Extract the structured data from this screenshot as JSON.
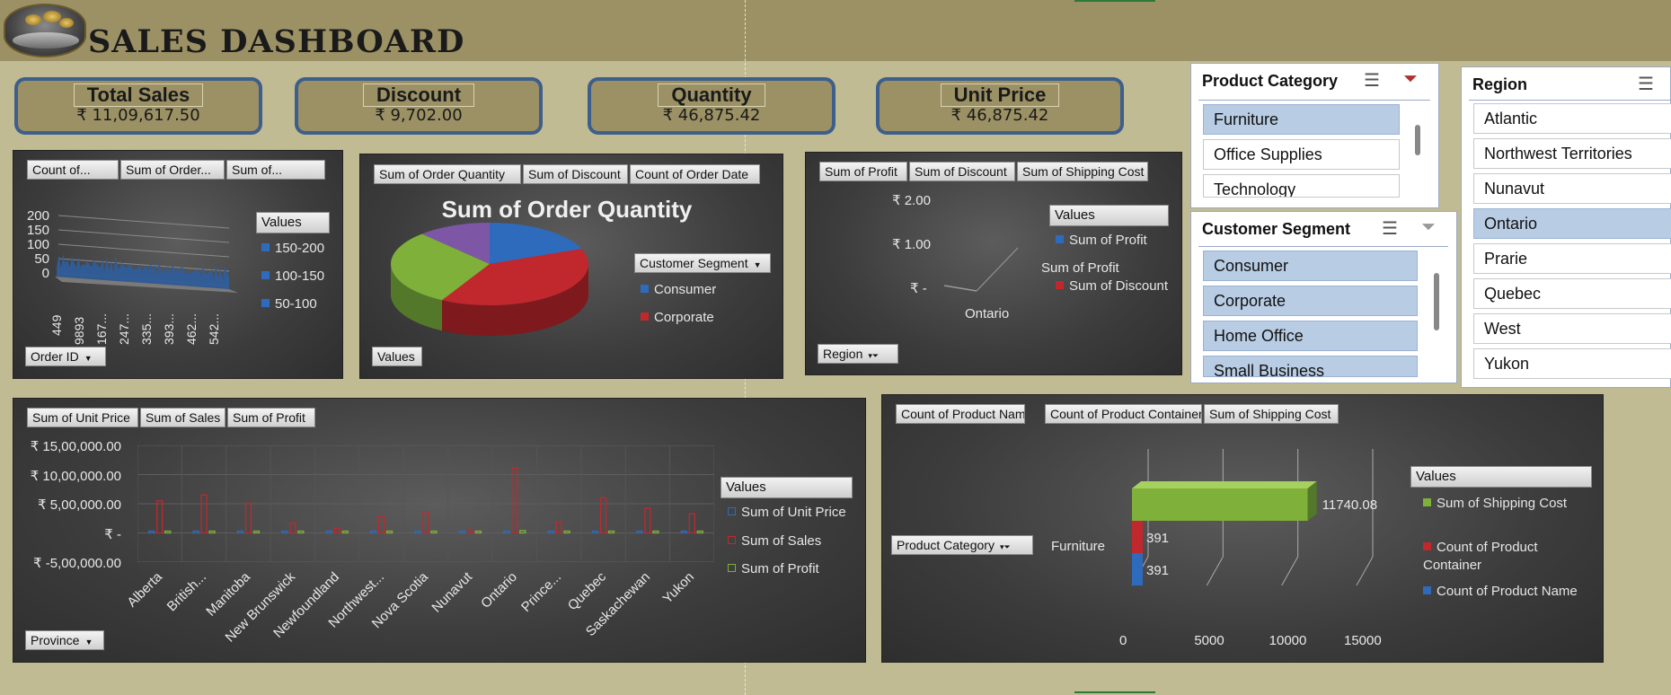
{
  "title": "SALES DASHBOARD",
  "kpis": [
    {
      "label": "Total Sales",
      "value": "₹ 11,09,617.50"
    },
    {
      "label": "Discount",
      "value": "₹ 9,702.00"
    },
    {
      "label": "Quantity",
      "value": "₹ 46,875.42"
    },
    {
      "label": "Unit Price",
      "value": "₹ 46,875.42"
    }
  ],
  "chart1": {
    "fields": [
      "Count of...",
      "Sum of Order...",
      "Sum of..."
    ],
    "axis_field": "Order ID",
    "legend_title": "Values",
    "legend": [
      "150-200",
      "100-150",
      "50-100"
    ],
    "y_ticks": [
      "200",
      "150",
      "100",
      "50",
      "0"
    ],
    "x_ticks": [
      "449",
      "9893",
      "167...",
      "247...",
      "335...",
      "393...",
      "462...",
      "542..."
    ]
  },
  "chart2": {
    "fields": [
      "Sum of Order Quantity",
      "Sum of Discount",
      "Count of Order Date"
    ],
    "title": "Sum of Order Quantity",
    "legend_field": "Customer Segment",
    "legend": [
      "Consumer",
      "Corporate"
    ],
    "values_button": "Values"
  },
  "chart3": {
    "fields": [
      "Sum of Profit",
      "Sum of Discount",
      "Sum of Shipping  Cost"
    ],
    "y_ticks": [
      "₹ 2.00",
      "₹ 1.00",
      "₹ -"
    ],
    "x_label": "Ontario",
    "legend_title": "Values",
    "legend": [
      "Sum of Profit",
      "Sum of Discount"
    ],
    "annotation": "Sum of Profit",
    "axis_field": "Region"
  },
  "chart4": {
    "fields": [
      "Sum of Unit Price",
      "Sum of Sales",
      "Sum of Profit"
    ],
    "y_ticks": [
      "₹ 15,00,000.00",
      "₹ 10,00,000.00",
      "₹ 5,00,000.00",
      "₹ -",
      "₹ -5,00,000.00"
    ],
    "legend_title": "Values",
    "legend": [
      "Sum of Unit Price",
      "Sum of Sales",
      "Sum of Profit"
    ],
    "axis_field": "Province"
  },
  "chart5": {
    "fields": [
      "Count of Product Name",
      "Count of Product Container",
      "Sum of Shipping  Cost"
    ],
    "filter_field": "Product Category",
    "category": "Furniture",
    "data_labels": [
      "11740.08",
      "391",
      "391"
    ],
    "x_ticks": [
      "0",
      "5000",
      "10000",
      "15000"
    ],
    "legend_title": "Values",
    "legend": [
      "Sum of Shipping Cost",
      "Count of Product Container",
      "Count of Product Name"
    ]
  },
  "slicers": {
    "product_category": {
      "title": "Product Category",
      "items": [
        "Furniture",
        "Office Supplies",
        "Technology"
      ]
    },
    "customer_segment": {
      "title": "Customer Segment",
      "items": [
        "Consumer",
        "Corporate",
        "Home Office",
        "Small Business"
      ]
    },
    "region": {
      "title": "Region",
      "items": [
        "Atlantic",
        "Northwest Territories",
        "Nunavut",
        "Ontario",
        "Prarie",
        "Quebec",
        "West",
        "Yukon"
      ]
    }
  },
  "chart_data": [
    {
      "type": "area",
      "series": [
        {
          "name": "50-100",
          "values": [
            40,
            55,
            35,
            60,
            45,
            50,
            30,
            65,
            42,
            38,
            55,
            48,
            36,
            58,
            44,
            52,
            33,
            61,
            47,
            40
          ]
        }
      ],
      "ylim": [
        0,
        200
      ]
    },
    {
      "type": "pie",
      "title": "Sum of Order Quantity",
      "categories": [
        "Consumer",
        "Corporate",
        "Home Office",
        "Small Business"
      ],
      "values": [
        19,
        39,
        30,
        12
      ]
    },
    {
      "type": "line",
      "categories": [
        "Ontario"
      ],
      "series": [
        {
          "name": "Sum of Profit",
          "values": [
            0
          ]
        },
        {
          "name": "Sum of Discount",
          "values": [
            0
          ]
        }
      ],
      "ylim": [
        0,
        2
      ]
    },
    {
      "type": "bar",
      "categories": [
        "Alberta",
        "British...",
        "Manitoba",
        "New Brunswick",
        "Newfoundland",
        "Northwest...",
        "Nova Scotia",
        "Nunavut",
        "Ontario",
        "Prince...",
        "Quebec",
        "Saskachewan",
        "Yukon"
      ],
      "series": [
        {
          "name": "Sum of Unit Price",
          "values": [
            9000,
            12000,
            8000,
            5000,
            3000,
            4000,
            6000,
            2000,
            15000,
            4000,
            10000,
            7000,
            5000
          ]
        },
        {
          "name": "Sum of Sales",
          "values": [
            550000,
            650000,
            510000,
            170000,
            80000,
            280000,
            360000,
            60000,
            1110000,
            180000,
            600000,
            420000,
            330000
          ]
        },
        {
          "name": "Sum of Profit",
          "values": [
            20000,
            30000,
            15000,
            5000,
            -3000,
            10000,
            12000,
            2000,
            40000,
            6000,
            22000,
            15000,
            9000
          ]
        }
      ],
      "ylim": [
        -500000,
        1500000
      ]
    },
    {
      "type": "bar",
      "categories": [
        "Furniture"
      ],
      "series": [
        {
          "name": "Count of Product Name",
          "values": [
            391
          ]
        },
        {
          "name": "Count of Product Container",
          "values": [
            391
          ]
        },
        {
          "name": "Sum of Shipping Cost",
          "values": [
            11740.08
          ]
        }
      ],
      "xlim": [
        0,
        15000
      ]
    }
  ],
  "colors": {
    "blue": "#2f6bbd",
    "red": "#c0282e",
    "green": "#7fb03a",
    "purple": "#7d57a6"
  }
}
